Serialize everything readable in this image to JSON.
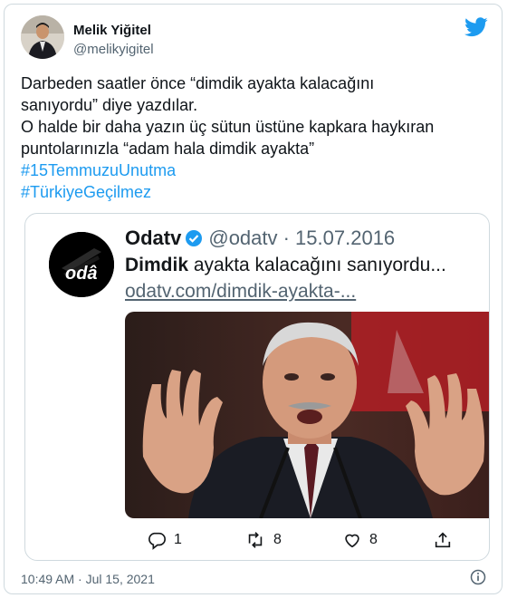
{
  "author": {
    "name": "Melik Yiğitel",
    "handle": "@melikyigitel"
  },
  "tweet": {
    "lines": [
      "Darbeden saatler önce “dimdik ayakta kalacağını",
      "sanıyordu” diye yazdılar.",
      "O halde bir daha yazın üç sütun üstüne kapkara haykıran",
      "puntolarınızla “adam hala dimdik ayakta”"
    ],
    "hashtags": [
      "#15TemmuzuUnutma",
      "#TürkiyeGeçilmez"
    ],
    "timestamp": "10:49 AM · Jul 15, 2021"
  },
  "embedded": {
    "name": "Odatv",
    "handle_date": "@odatv · 15.07.2016",
    "text_bold": "Dimdik",
    "text_rest": " ayakta kalacağını sanıyordu...",
    "link": "odatv.com/dimdik-ayakta-...",
    "logo_text": "odâ",
    "replies": "1",
    "retweets": "8",
    "likes": "8"
  },
  "colors": {
    "accent": "#1d9bf0",
    "text": "#0f1419",
    "secondary": "#536471",
    "border": "#cfd9de"
  },
  "icons": [
    "twitter-bird-icon",
    "verified-badge-icon",
    "reply-icon",
    "retweet-icon",
    "like-icon",
    "share-icon",
    "info-icon"
  ]
}
